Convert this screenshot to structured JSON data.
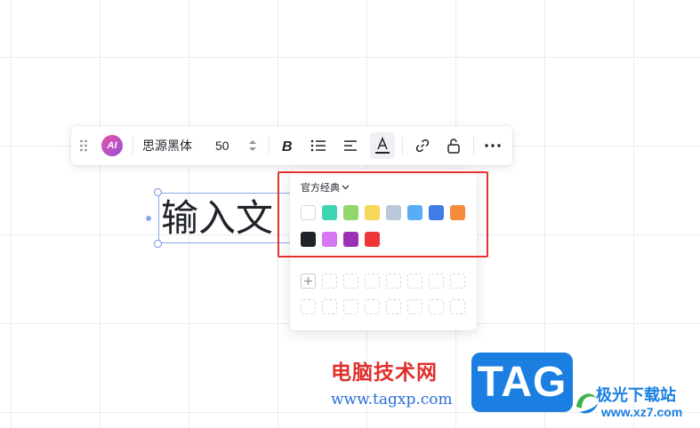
{
  "toolbar": {
    "ai_label": "AI",
    "font_family": "思源黑体",
    "font_size": "50",
    "buttons": [
      "bold",
      "bullet-list",
      "align",
      "text-color",
      "link",
      "unlock",
      "more"
    ]
  },
  "canvas": {
    "text_content": "输入文"
  },
  "color_panel": {
    "palette_name": "官方经典",
    "swatches": [
      {
        "name": "white",
        "color": "#ffffff"
      },
      {
        "name": "teal",
        "color": "#3dd6b3"
      },
      {
        "name": "light-green",
        "color": "#93d66c"
      },
      {
        "name": "yellow",
        "color": "#f7d757"
      },
      {
        "name": "gray-blue",
        "color": "#b9c9da"
      },
      {
        "name": "sky-blue",
        "color": "#58adf4"
      },
      {
        "name": "blue",
        "color": "#3f7ce6"
      },
      {
        "name": "orange",
        "color": "#f68a3f"
      },
      {
        "name": "black",
        "color": "#1f2329"
      },
      {
        "name": "violet",
        "color": "#d576f3"
      },
      {
        "name": "purple",
        "color": "#9b2fb5"
      },
      {
        "name": "red",
        "color": "#ef3636"
      }
    ]
  },
  "watermark": {
    "cn_name": "电脑技术网",
    "url": "www.tagxp.com",
    "tag": "TAG",
    "site_name": "极光下载站",
    "site_url": "www.xz7.com"
  },
  "colors": {
    "highlight": "#e5322d",
    "selection": "#8aa4e6",
    "accent": "#1a7fe0"
  }
}
